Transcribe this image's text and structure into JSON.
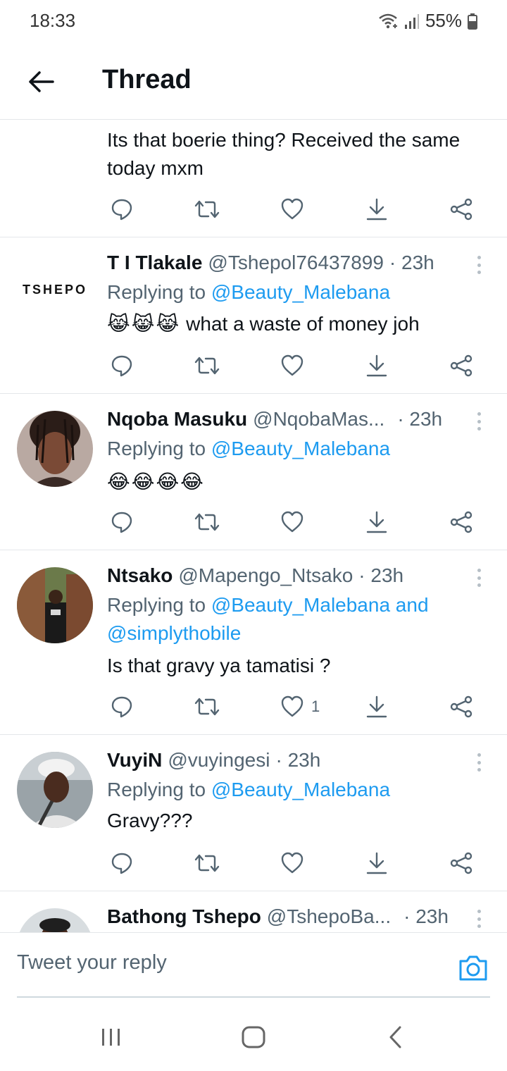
{
  "status_bar": {
    "time": "18:33",
    "battery": "55%"
  },
  "header": {
    "title": "Thread"
  },
  "tweets": [
    {
      "text": "Its that boerie thing? Received the same today mxm"
    },
    {
      "name": "T I Tlakale",
      "handle": "@Tshepol76437899",
      "time": "· 23h",
      "avatar_text": "TSHEPO",
      "replying_prefix": "Replying to",
      "mentions": "@Beauty_Malebana",
      "emojis": [
        "😹",
        "😹",
        "😹"
      ],
      "text": "what a waste of money joh"
    },
    {
      "name": "Nqoba Masuku",
      "handle": "@NqobaMas...",
      "time": "· 23h",
      "replying_prefix": "Replying to",
      "mentions": "@Beauty_Malebana",
      "emojis": [
        "😂",
        "😂",
        "😂",
        "😂"
      ]
    },
    {
      "name": "Ntsako",
      "handle": "@Mapengo_Ntsako",
      "time": "· 23h",
      "replying_prefix": "Replying to",
      "mentions": "@Beauty_Malebana and",
      "mentions_2": "@simplythobile",
      "text": "Is that gravy ya tamatisi ?",
      "like_count": "1"
    },
    {
      "name": "VuyiN",
      "handle": "@vuyingesi",
      "time": "· 23h",
      "replying_prefix": "Replying to",
      "mentions": "@Beauty_Malebana",
      "text": "Gravy???"
    },
    {
      "name": "Bathong Tshepo",
      "handle": "@TshepoBa...",
      "time": "· 23h"
    }
  ],
  "compose": {
    "placeholder": "Tweet your reply"
  },
  "icons": {
    "reply": "reply-icon",
    "retweet": "retweet-icon",
    "like": "heart-icon",
    "download": "download-icon",
    "share": "share-icon",
    "camera": "camera-icon"
  },
  "colors": {
    "accent": "#1d9bf0",
    "muted": "#536471",
    "text": "#0f1419",
    "divider": "#e4e7ea"
  }
}
